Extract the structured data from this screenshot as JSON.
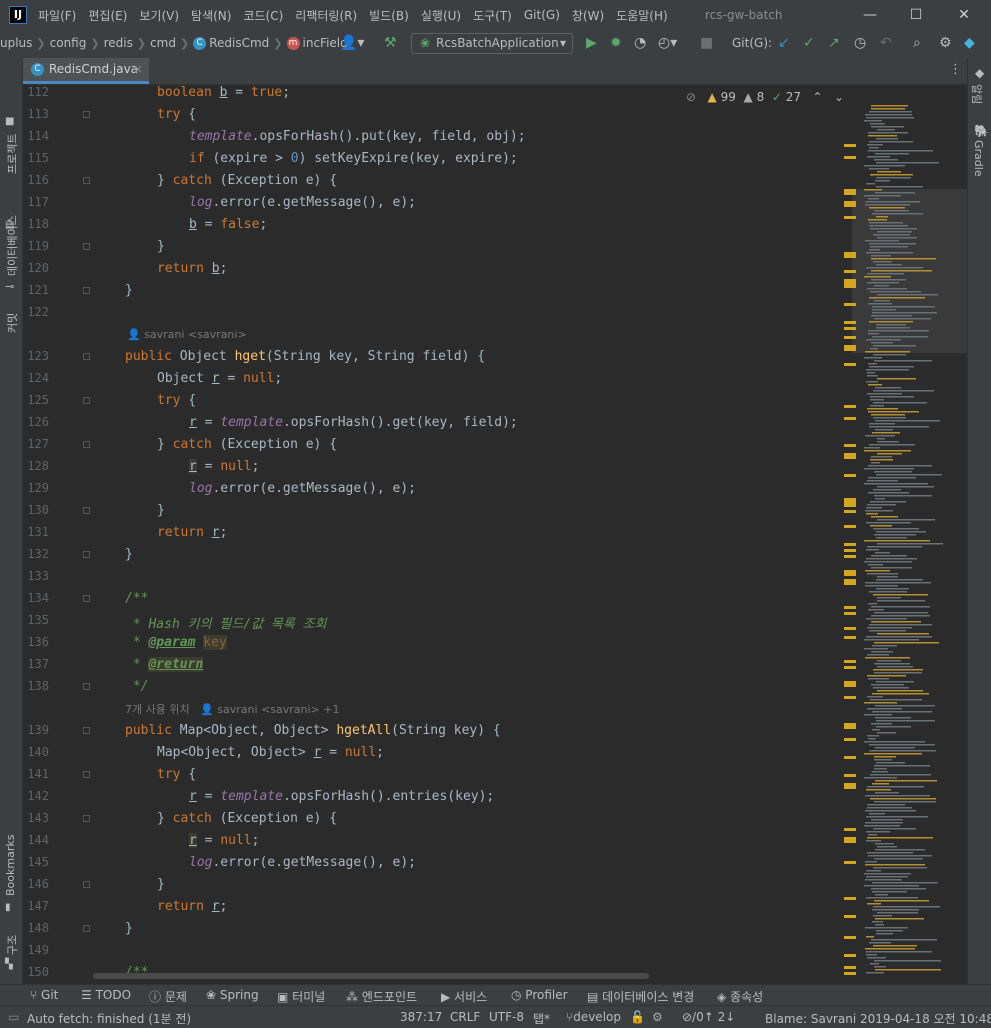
{
  "window": {
    "title": "rcs-gw-batch",
    "app_icon": "IJ",
    "menu": [
      "파일(F)",
      "편집(E)",
      "보기(V)",
      "탐색(N)",
      "코드(C)",
      "리팩터링(R)",
      "빌드(B)",
      "실행(U)",
      "도구(T)",
      "Git(G)",
      "창(W)",
      "도움말(H)"
    ]
  },
  "breadcrumb": {
    "items": [
      "uplus",
      "config",
      "redis",
      "cmd",
      "RedisCmd",
      "incField"
    ],
    "run_config": "RcsBatchApplication",
    "git_label": "Git(G):"
  },
  "tab": {
    "label": "RedisCmd.java"
  },
  "left_panels": [
    "프로젝트",
    "데이터베이스",
    "커밋",
    "Bookmarks",
    "구조"
  ],
  "right_panels": [
    "알림",
    "Gradle"
  ],
  "indicators": {
    "warnings": "99",
    "weak": "8",
    "ok": "27"
  },
  "hints": {
    "author1": "savrani <savrani>",
    "usages": "7개 사용 위치",
    "author2": "savrani <savrani> +1"
  },
  "line_numbers": [
    "112",
    "113",
    "114",
    "115",
    "116",
    "117",
    "118",
    "119",
    "120",
    "121",
    "122",
    "123",
    "124",
    "125",
    "126",
    "127",
    "128",
    "129",
    "130",
    "131",
    "132",
    "133",
    "134",
    "135",
    "136",
    "137",
    "138",
    "139",
    "140",
    "141",
    "142",
    "143",
    "144",
    "145",
    "146",
    "147",
    "148",
    "149",
    "150"
  ],
  "tool_windows": [
    "Git",
    "TODO",
    "문제",
    "Spring",
    "터미널",
    "엔드포인트",
    "서비스",
    "Profiler",
    "데이터베이스 변경",
    "종속성"
  ],
  "status": {
    "message": "Auto fetch: finished (1분 전)",
    "position": "387:17",
    "line_sep": "CRLF",
    "encoding": "UTF-8",
    "indent": "탭*",
    "branch": "develop",
    "sync": "⊘/0↑ 2↓",
    "blame": "Blame: Savrani 2019-04-18 오전 10:48"
  },
  "colors": {
    "keyword": "#cc7832",
    "field": "#9876aa",
    "function": "#ffc66d",
    "number": "#6897bb",
    "comment": "#629755",
    "accent": "#4a88c7"
  }
}
